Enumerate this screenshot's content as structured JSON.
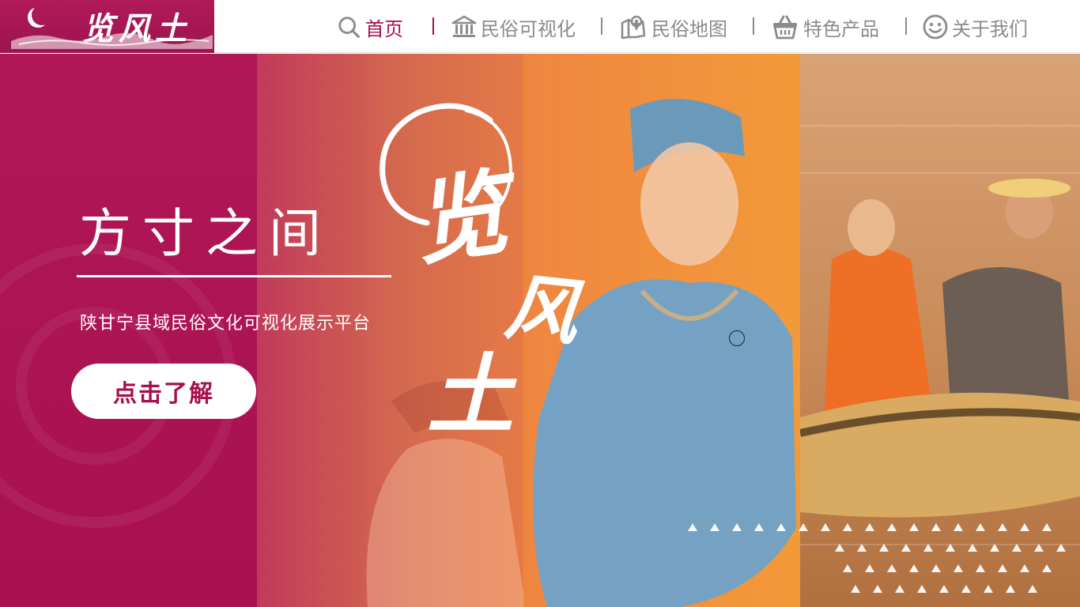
{
  "logo": {
    "text": "览风土"
  },
  "nav": {
    "items": [
      {
        "label": "首页",
        "icon": "search-icon",
        "active": true
      },
      {
        "label": "民俗可视化",
        "icon": "museum-icon",
        "active": false
      },
      {
        "label": "民俗地图",
        "icon": "map-pin-icon",
        "active": false
      },
      {
        "label": "特色产品",
        "icon": "basket-icon",
        "active": false
      },
      {
        "label": "关于我们",
        "icon": "smiley-icon",
        "active": false
      }
    ]
  },
  "hero": {
    "slogan": "方寸之间",
    "calligraphy": [
      "览",
      "风",
      "土"
    ],
    "subtitle": "陕甘宁县域民俗文化可视化展示平台",
    "cta_label": "点击了解"
  },
  "colors": {
    "brand": "#a5104e",
    "nav_text": "#8b8b8b",
    "panel_1": "#b01757",
    "panel_2": "#d4694f",
    "panel_3": "#f29a3a",
    "panel_4": "#c88a58"
  }
}
